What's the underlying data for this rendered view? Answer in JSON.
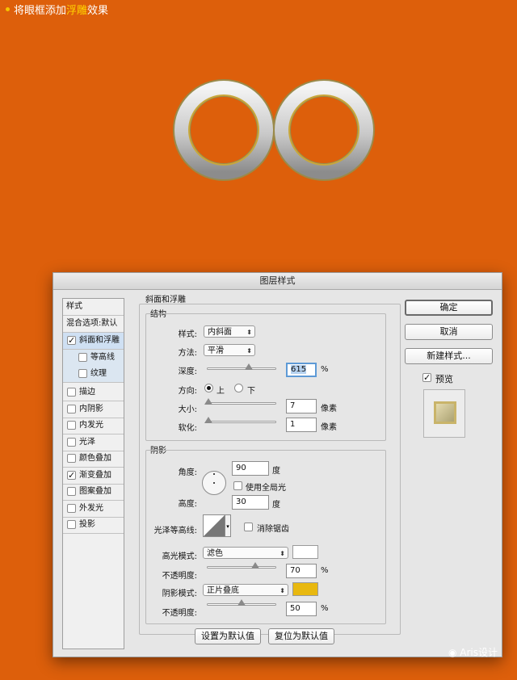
{
  "caption": {
    "prefix": "将眼框添加",
    "highlight": "浮雕",
    "suffix": "效果"
  },
  "dialog": {
    "title": "图层样式",
    "styles_header": "样式",
    "blend_options": "混合选项:默认",
    "items": [
      {
        "label": "斜面和浮雕",
        "checked": true
      },
      {
        "label": "等高线",
        "checked": false
      },
      {
        "label": "纹理",
        "checked": false
      },
      {
        "label": "描边",
        "checked": false
      },
      {
        "label": "内阴影",
        "checked": false
      },
      {
        "label": "内发光",
        "checked": false
      },
      {
        "label": "光泽",
        "checked": false
      },
      {
        "label": "颜色叠加",
        "checked": false
      },
      {
        "label": "渐变叠加",
        "checked": true
      },
      {
        "label": "图案叠加",
        "checked": false
      },
      {
        "label": "外发光",
        "checked": false
      },
      {
        "label": "投影",
        "checked": false
      }
    ],
    "bevel": {
      "section_title": "斜面和浮雕",
      "structure_title": "结构",
      "style_label": "样式:",
      "style_value": "内斜面",
      "technique_label": "方法:",
      "technique_value": "平滑",
      "depth_label": "深度:",
      "depth_value": "615",
      "depth_unit": "%",
      "depth_slider": 0.6,
      "direction_label": "方向:",
      "direction_up": "上",
      "direction_down": "下",
      "size_label": "大小:",
      "size_value": "7",
      "size_unit": "像素",
      "size_slider": 0.02,
      "soften_label": "软化:",
      "soften_value": "1",
      "soften_unit": "像素",
      "soften_slider": 0.02
    },
    "shading": {
      "title": "阴影",
      "angle_label": "角度:",
      "angle_value": "90",
      "angle_unit": "度",
      "global_light": "使用全局光",
      "altitude_label": "高度:",
      "altitude_value": "30",
      "altitude_unit": "度",
      "gloss_label": "光泽等高线:",
      "anti_alias": "消除锯齿",
      "highlight_mode_label": "高光模式:",
      "highlight_mode_value": "滤色",
      "highlight_color": "#ffffff",
      "opacity1_label": "不透明度:",
      "opacity1_value": "70",
      "opacity1_unit": "%",
      "opacity1_slider": 0.7,
      "shadow_mode_label": "阴影模式:",
      "shadow_mode_value": "正片叠底",
      "shadow_color": "#e8b80f",
      "opacity2_label": "不透明度:",
      "opacity2_value": "50",
      "opacity2_unit": "%",
      "opacity2_slider": 0.5
    },
    "make_default": "设置为默认值",
    "reset_default": "复位为默认值",
    "ok": "确定",
    "cancel": "取消",
    "new_style": "新建样式...",
    "preview": "预览"
  },
  "watermark": "Aris设计"
}
